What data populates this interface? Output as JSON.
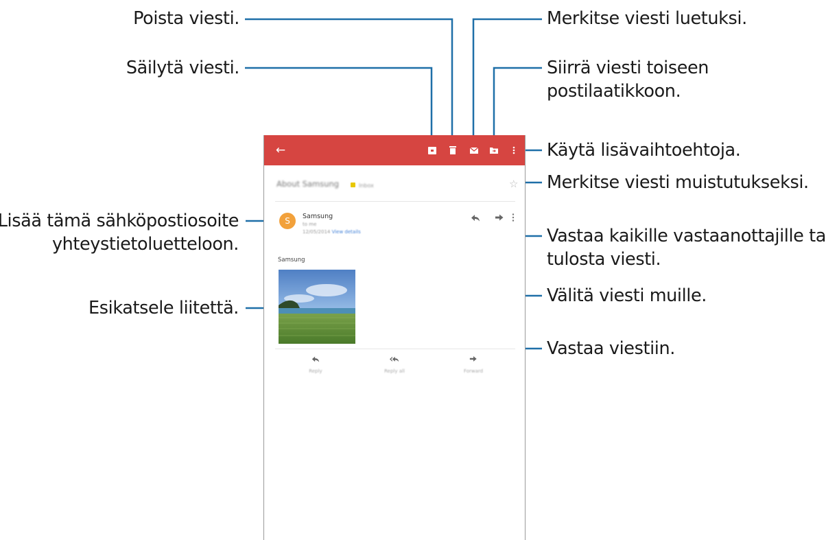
{
  "callouts": {
    "delete": "Poista viesti.",
    "keep": "Säilytä viesti.",
    "mark_read": "Merkitse viesti luetuksi.",
    "move_line1": "Siirrä viesti toiseen",
    "move_line2": "postilaatikkoon.",
    "more_options": "Käytä lisävaihtoehtoja.",
    "reminder": "Merkitse viesti muistutukseksi.",
    "add_contact_line1": "Lisää tämä sähköpostiosoite",
    "add_contact_line2": "yhteystietoluetteloon.",
    "reply_all_print_line1": "Vastaa kaikille vastaanottajille tai",
    "reply_all_print_line2": "tulosta viesti.",
    "forward": "Välitä viesti muille.",
    "preview": "Esikatsele liitettä.",
    "reply": "Vastaa viestiin."
  },
  "email": {
    "subject": "About Samsung",
    "subject_tag": "Inbox",
    "sender_initial": "S",
    "sender_name": "Samsung",
    "recipient": "to me",
    "date": "12/05/2014",
    "view_details": "View details",
    "body": "Samsung"
  },
  "actions": {
    "reply": "Reply",
    "reply_all": "Reply all",
    "forward": "Forward"
  },
  "colors": {
    "appbar": "#d64541",
    "avatar": "#f2a13b",
    "leader_line": "#1e6fa8"
  }
}
